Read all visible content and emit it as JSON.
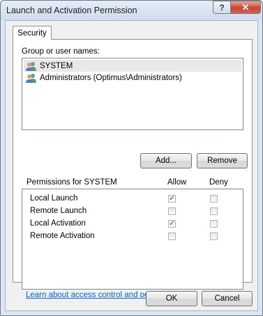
{
  "window": {
    "title": "Launch and Activation Permission",
    "help_glyph": "?",
    "close_glyph": "✕"
  },
  "tabs": [
    {
      "label": "Security"
    }
  ],
  "group_label": "Group or user names:",
  "users": [
    {
      "name": "SYSTEM",
      "selected": true
    },
    {
      "name": "Administrators (Optimus\\Administrators)",
      "selected": false
    }
  ],
  "buttons": {
    "add": "Add...",
    "remove": "Remove",
    "ok": "OK",
    "cancel": "Cancel"
  },
  "permissions": {
    "header": "Permissions for SYSTEM",
    "allow_label": "Allow",
    "deny_label": "Deny",
    "items": [
      {
        "name": "Local Launch",
        "allow": true,
        "deny": false
      },
      {
        "name": "Remote Launch",
        "allow": false,
        "deny": false
      },
      {
        "name": "Local Activation",
        "allow": true,
        "deny": false
      },
      {
        "name": "Remote Activation",
        "allow": false,
        "deny": false
      }
    ]
  },
  "help_link": "Learn about access control and permissions"
}
